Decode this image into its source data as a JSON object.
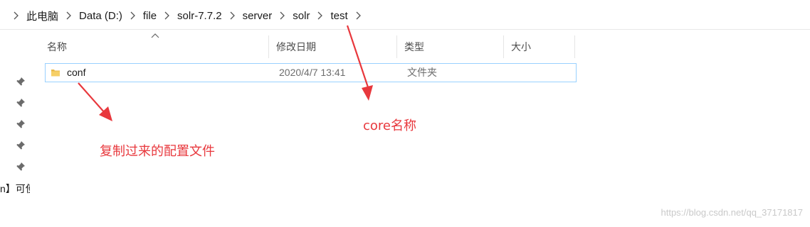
{
  "breadcrumb": {
    "items": [
      "此电脑",
      "Data (D:)",
      "file",
      "solr-7.7.2",
      "server",
      "solr",
      "test"
    ]
  },
  "nav": {
    "partial_text": "n】可使"
  },
  "columns": {
    "name": "名称",
    "date": "修改日期",
    "type": "类型",
    "size": "大小"
  },
  "files": [
    {
      "name": "conf",
      "date": "2020/4/7 13:41",
      "type": "文件夹",
      "size": ""
    }
  ],
  "annotations": {
    "core": "core名称",
    "conf": "复制过来的配置文件"
  },
  "watermark": "https://blog.csdn.net/qq_37171817",
  "colors": {
    "annotation": "#e8383d",
    "selection_border": "#99d1ff",
    "folder": "#e8b84a"
  }
}
